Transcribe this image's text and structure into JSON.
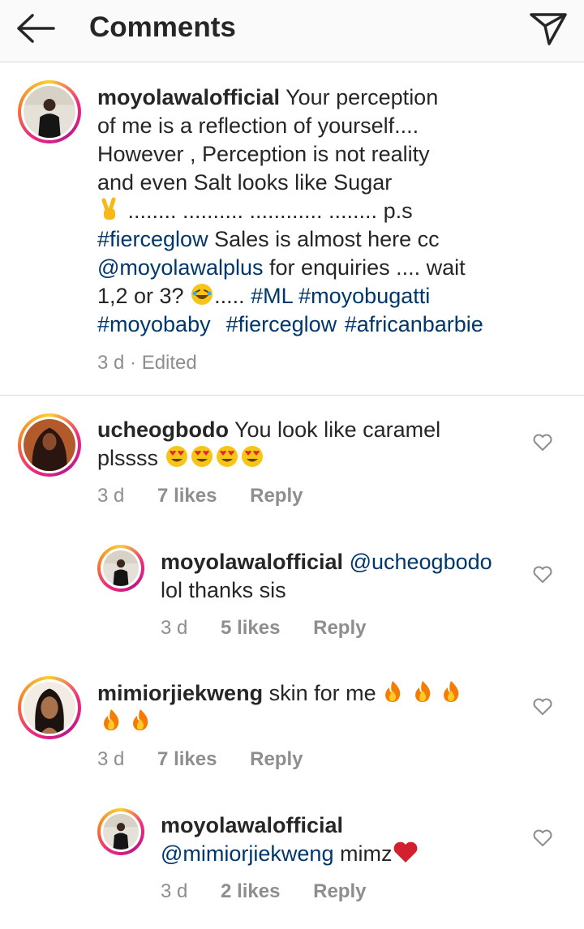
{
  "header": {
    "title": "Comments"
  },
  "caption": {
    "username": "moyolawalofficial",
    "line1": " Your perception",
    "line2": "of me is a reflection of yourself....",
    "line3": "However , Perception is not reality",
    "line4": "and even Salt looks like Sugar",
    "line5_dots": " ........ .......... ............ ........ p.s",
    "line6_tag": "#fierceglow",
    "line6_rest": " Sales is almost here cc",
    "line7_tag": "@moyolawalplus",
    "line7_rest": " for enquiries .... wait",
    "line8_text": "1,2 or 3? ",
    "line8_dots": "..... ",
    "line8_tag1": "#ML",
    "line8_space": " ",
    "line8_tag2": "#moyobugatti",
    "line9_tag1": "#moyobaby",
    "line9_tag2": "#fierceglow",
    "line9_tag3": "#africanbarbie",
    "meta": "3 d · Edited"
  },
  "comments": [
    {
      "username": "ucheogbodo",
      "text1": " You look like caramel",
      "text2": "plssss ",
      "time": "3 d",
      "likes": "7 likes",
      "reply": "Reply"
    },
    {
      "username": "moyolawalofficial",
      "mention": "@ucheogbodo",
      "text2": "lol thanks sis",
      "time": "3 d",
      "likes": "5 likes",
      "reply": "Reply"
    },
    {
      "username": "mimiorjiekweng",
      "text1": " skin for me ",
      "time": "3 d",
      "likes": "7 likes",
      "reply": "Reply"
    },
    {
      "username": "moyolawalofficial",
      "mention": "@mimiorjiekweng",
      "text2": " mimz",
      "time": "3 d",
      "likes": "2 likes",
      "reply": "Reply"
    }
  ],
  "icons": {
    "back": "arrow-left-icon",
    "share": "paper-plane-icon",
    "like": "heart-outline-icon"
  },
  "colors": {
    "link": "#00376b",
    "meta": "#8e8e8e",
    "text": "#262626",
    "divider": "#dbdbdb"
  }
}
